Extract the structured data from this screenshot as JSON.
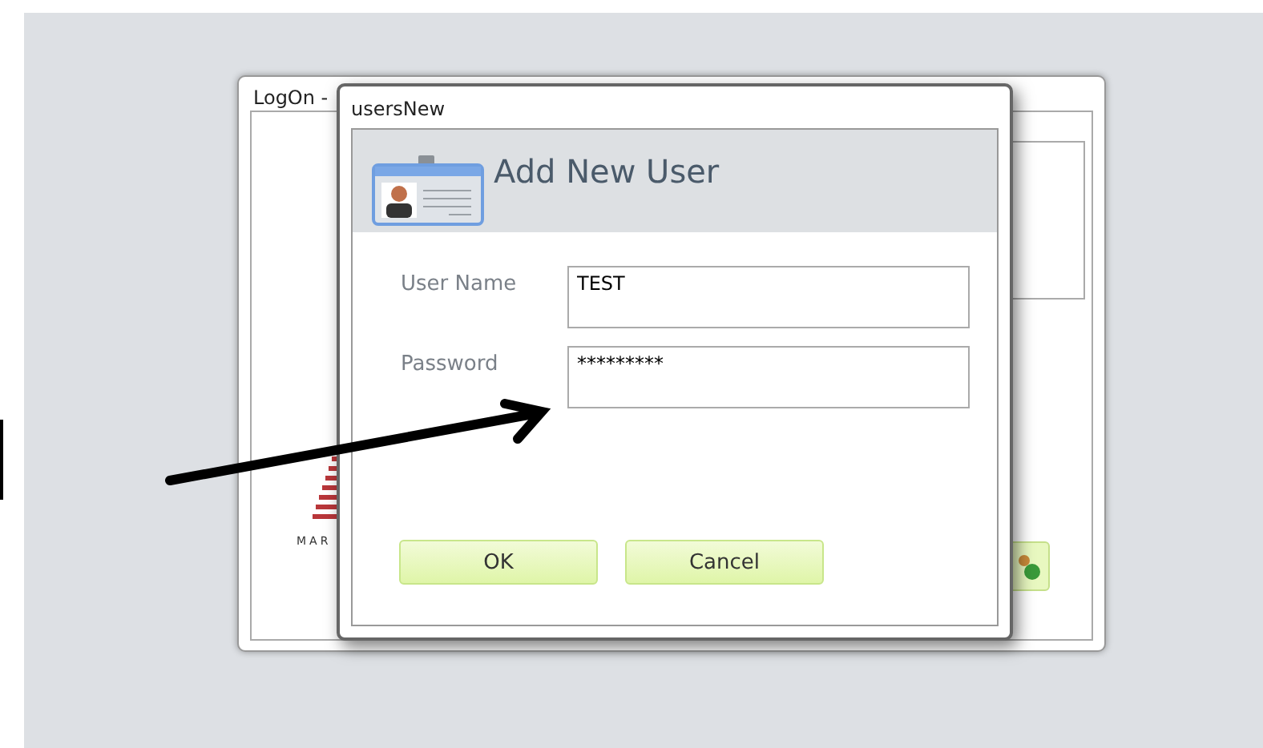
{
  "logon_window": {
    "title": "LogOn -",
    "logo_text": "MAR"
  },
  "dialog": {
    "title": "usersNew",
    "heading": "Add New User",
    "fields": [
      {
        "label": "User Name",
        "value": "TEST"
      },
      {
        "label": "Password",
        "value": "*********"
      }
    ],
    "buttons": [
      "OK",
      "Cancel"
    ]
  }
}
